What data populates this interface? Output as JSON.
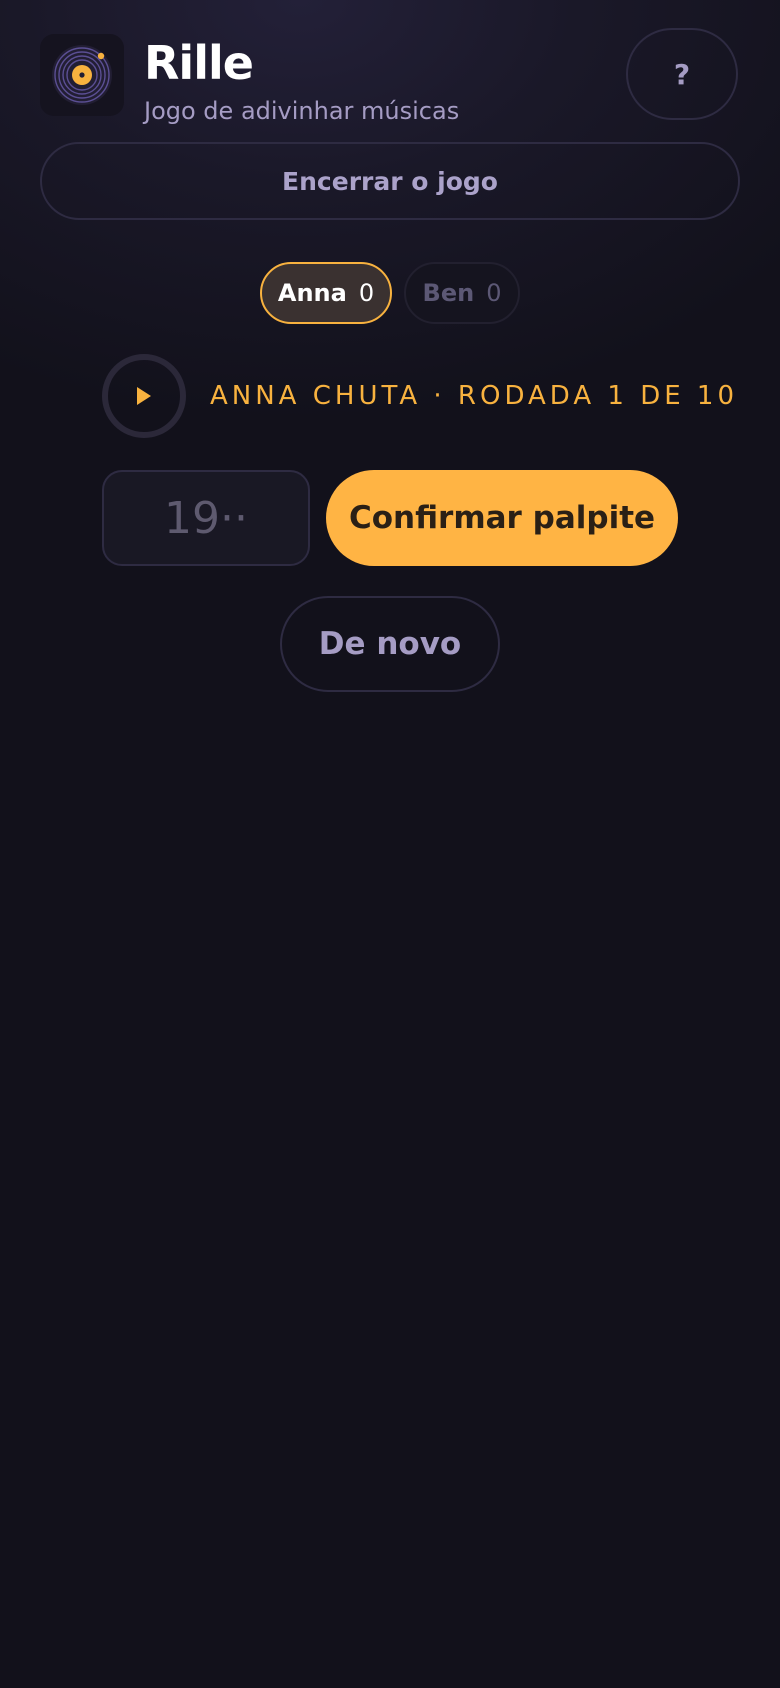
{
  "app": {
    "title": "Rille",
    "subtitle": "Jogo de adivinhar músicas",
    "help_label": "?",
    "logo_icon": "vinyl-record-icon"
  },
  "controls": {
    "end_game_label": "Encerrar o jogo"
  },
  "players": [
    {
      "name": "Anna",
      "score": "0",
      "active": true
    },
    {
      "name": "Ben",
      "score": "0",
      "active": false
    }
  ],
  "round": {
    "status_text": "ANNA CHUTA · RODADA 1 DE 10",
    "play_icon": "play-icon"
  },
  "guess": {
    "placeholder": "19··",
    "value": "",
    "confirm_label": "Confirmar palpite",
    "again_label": "De novo"
  },
  "colors": {
    "accent": "#ffb444",
    "background": "#12111b",
    "muted_text": "#a59cc4",
    "border": "#2e2b42"
  }
}
